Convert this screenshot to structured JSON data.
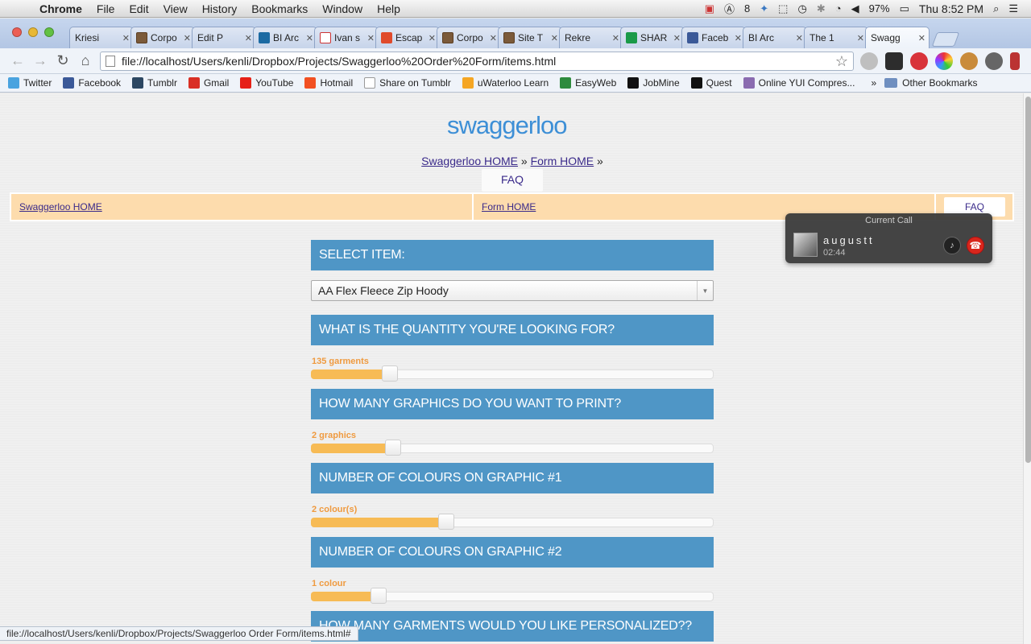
{
  "menubar": {
    "app": "Chrome",
    "items": [
      "File",
      "Edit",
      "View",
      "History",
      "Bookmarks",
      "Window",
      "Help"
    ],
    "status": {
      "adobe_count": "8",
      "battery": "97%",
      "clock": "Thu 8:52 PM"
    }
  },
  "tabs": [
    {
      "title": "Kriesi",
      "icon": "page"
    },
    {
      "title": "Corpo",
      "icon": "img"
    },
    {
      "title": "Edit P",
      "icon": "page"
    },
    {
      "title": "BI Arc",
      "icon": "li"
    },
    {
      "title": "Ivan s",
      "icon": "gm"
    },
    {
      "title": "Escap",
      "icon": "nsu"
    },
    {
      "title": "Corpo",
      "icon": "img"
    },
    {
      "title": "Site T",
      "icon": "img"
    },
    {
      "title": "Rekre",
      "icon": "none"
    },
    {
      "title": "SHAR",
      "icon": "sh"
    },
    {
      "title": "Faceb",
      "icon": "fb"
    },
    {
      "title": "BI Arc",
      "icon": "page"
    },
    {
      "title": "The 1",
      "icon": "page"
    },
    {
      "title": "Swagg",
      "icon": "page",
      "active": true
    }
  ],
  "address": {
    "url": "file://localhost/Users/kenli/Dropbox/Projects/Swaggerloo%20Order%20Form/items.html"
  },
  "bookmarks": [
    {
      "label": "Twitter",
      "color": "#4aa3df"
    },
    {
      "label": "Facebook",
      "color": "#3b5998"
    },
    {
      "label": "Tumblr",
      "color": "#2c4762"
    },
    {
      "label": "Gmail",
      "color": "#d93025"
    },
    {
      "label": "YouTube",
      "color": "#e62117"
    },
    {
      "label": "Hotmail",
      "color": "#f25022"
    },
    {
      "label": "Share on Tumblr",
      "color": "#ffffff"
    },
    {
      "label": "uWaterloo Learn",
      "color": "#f5a623"
    },
    {
      "label": "EasyWeb",
      "color": "#2e8b3d"
    },
    {
      "label": "JobMine",
      "color": "#111111"
    },
    {
      "label": "Quest",
      "color": "#111111"
    },
    {
      "label": "Online YUI Compres...",
      "color": "#8a6bb0"
    }
  ],
  "bookmarks_more": "»",
  "bookmarks_other": "Other Bookmarks",
  "site": {
    "logo": "swaggerloo",
    "crumb_home": "Swaggerloo HOME",
    "crumb_sep": "»",
    "crumb_form": "Form HOME",
    "crumb_sep2": "»",
    "faq": "FAQ",
    "nav": {
      "home": "Swaggerloo HOME",
      "form": "Form HOME",
      "faq": "FAQ"
    }
  },
  "form": {
    "select_heading": "SELECT ITEM:",
    "selected_item": "AA Flex Fleece Zip Hoody",
    "questions": [
      {
        "heading": "WHAT IS THE QUANTITY YOU'RE LOOKING FOR?",
        "value_label": "135 garments",
        "level": 0.195
      },
      {
        "heading": "HOW MANY GRAPHICS DO YOU WANT TO PRINT?",
        "value_label": "2 graphics",
        "level": 0.203
      },
      {
        "heading": "NUMBER OF COLOURS ON GRAPHIC #1",
        "value_label": "2 colour(s)",
        "level": 0.335
      },
      {
        "heading": "NUMBER OF COLOURS ON GRAPHIC #2",
        "value_label": "1 colour",
        "level": 0.168
      }
    ],
    "partial_heading": "HOW MANY GARMENTS WOULD YOU LIKE PERSONALIZED??"
  },
  "call": {
    "title": "Current Call",
    "name": "augustt",
    "duration": "02:44"
  },
  "statusbar": "file://localhost/Users/kenli/Dropbox/Projects/Swaggerloo Order Form/items.html#",
  "colors": {
    "accent_blue": "#4f96c6",
    "slider_fill": "#f7bb55",
    "slider_label": "#ef9a3f",
    "nav_bg": "#fddcad",
    "logo": "#3d8fd6"
  }
}
